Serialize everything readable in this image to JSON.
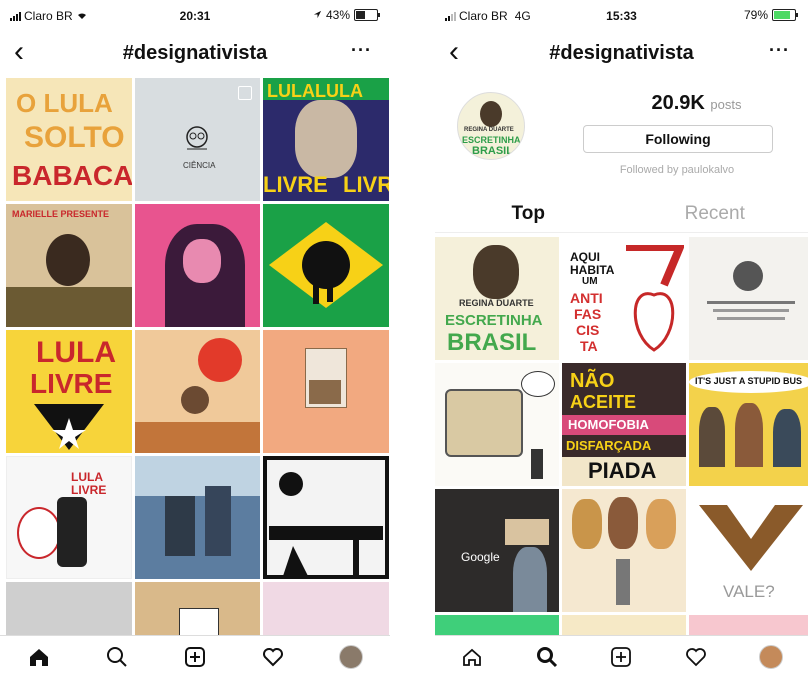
{
  "left": {
    "status": {
      "carrier": "Claro BR",
      "time": "20:31",
      "battery": "43%"
    },
    "nav": {
      "back": "‹",
      "title": "#designativista",
      "more": "···"
    },
    "tiles": {
      "t1": [
        "O LULA",
        "SOLTO",
        "BABACA"
      ],
      "t2": "CIÊNCIA",
      "t3": [
        "LULALULA",
        "LIVRE",
        "LIVRE"
      ],
      "t4": "MARIELLE PRESENTE",
      "t7": [
        "LULA",
        "LIVRE"
      ],
      "t10": [
        "LULA",
        "LIVRE"
      ]
    }
  },
  "right": {
    "status": {
      "carrier": "Claro BR",
      "network": "4G",
      "time": "15:33",
      "battery": "79%"
    },
    "nav": {
      "back": "‹",
      "title": "#designativista",
      "more": "···"
    },
    "profile": {
      "posts_count": "20.9K",
      "posts_label": "posts",
      "follow_button": "Following",
      "followed_by": "Followed by paulokalvo"
    },
    "avatar_text": [
      "REGINA DUARTE",
      "ESCRETINHA",
      "BRASIL"
    ],
    "tabs": {
      "top": "Top",
      "recent": "Recent"
    },
    "tiles": {
      "r1": [
        "REGINA DUARTE",
        "ESCRETINHA",
        "BRASIL"
      ],
      "r2": [
        "AQUI",
        "HABITA",
        "UM",
        "ANTI",
        "FAS",
        "CIS",
        "TA"
      ],
      "r5": [
        "NÃO",
        "ACEITE",
        "HOMOFOBIA",
        "DISFARÇADA",
        "PIADA"
      ],
      "r6": "IT'S JUST A STUPID BUS",
      "r7": "Google",
      "r9": "VALE?"
    }
  },
  "colors": {
    "accent_red": "#d32f2f",
    "brazil_green": "#1aa147",
    "brazil_yellow": "#f7d117"
  }
}
